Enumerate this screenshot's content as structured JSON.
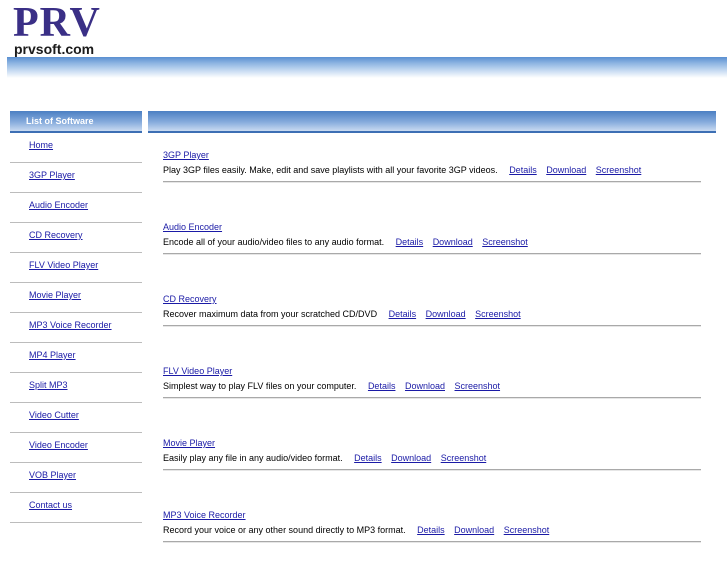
{
  "logo": {
    "big": "PRV",
    "small": "prvsoft.com"
  },
  "sidebar": {
    "header": "List of Software",
    "items": [
      "Home",
      "3GP Player",
      "Audio Encoder",
      "CD Recovery",
      "FLV Video Player",
      "Movie Player",
      "MP3 Voice Recorder",
      "MP4 Player",
      "Split MP3",
      "Video Cutter",
      "Video Encoder",
      "VOB Player",
      "Contact us"
    ]
  },
  "products": [
    {
      "title": "3GP Player",
      "desc": "Play 3GP files easily. Make, edit and save playlists with all your favorite 3GP videos.",
      "details": "Details",
      "download": "Download",
      "screenshot": "Screenshot"
    },
    {
      "title": "Audio Encoder",
      "desc": "Encode all of your audio/video files to any audio format.",
      "details": "Details",
      "download": "Download",
      "screenshot": "Screenshot"
    },
    {
      "title": "CD Recovery",
      "desc": "Recover maximum data from your scratched CD/DVD",
      "details": "Details",
      "download": "Download",
      "screenshot": "Screenshot"
    },
    {
      "title": "FLV Video Player",
      "desc": "Simplest way to play FLV files on your computer.",
      "details": "Details",
      "download": "Download",
      "screenshot": "Screenshot"
    },
    {
      "title": "Movie Player",
      "desc": "Easily play any file in any audio/video format.",
      "details": "Details",
      "download": "Download",
      "screenshot": "Screenshot"
    },
    {
      "title": "MP3 Voice Recorder",
      "desc": "Record your voice or any other sound directly to MP3 format.",
      "details": "Details",
      "download": "Download",
      "screenshot": "Screenshot"
    }
  ]
}
